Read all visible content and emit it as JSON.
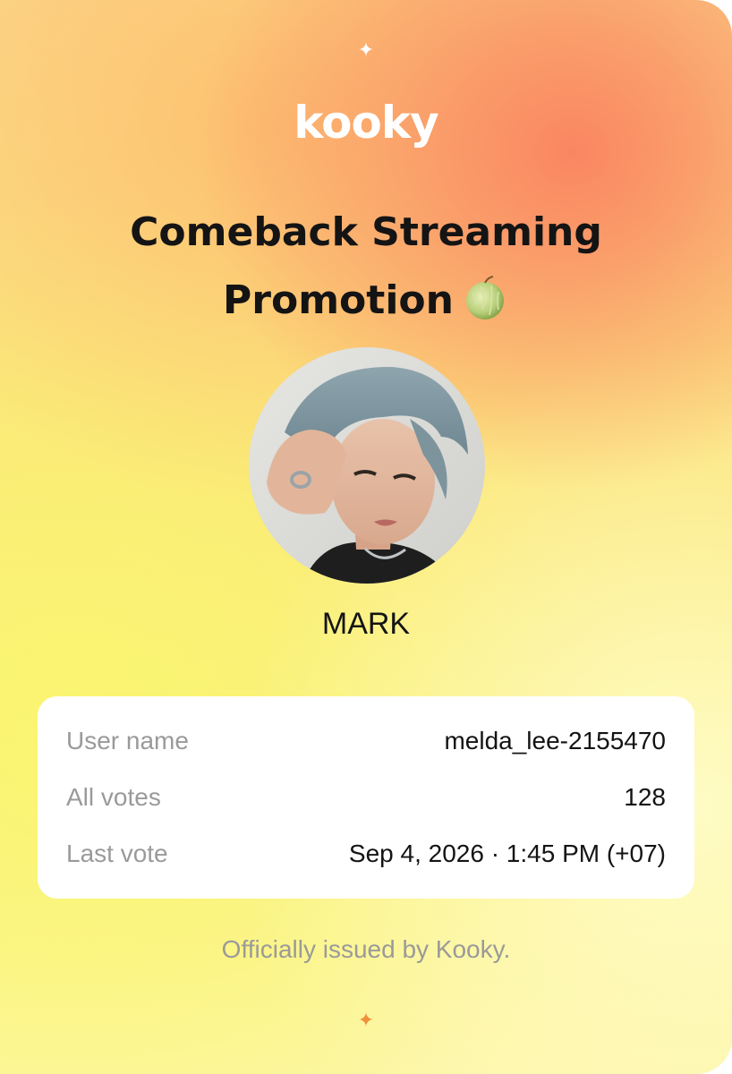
{
  "brand": {
    "name": "kooky"
  },
  "promotion": {
    "title_line1": "Comeback Streaming",
    "title_line2": "Promotion",
    "title_emoji_icon": "melon-icon"
  },
  "artist": {
    "name": "MARK"
  },
  "info": {
    "rows": [
      {
        "label": "User name",
        "value": "melda_lee-2155470"
      },
      {
        "label": "All votes",
        "value": "128"
      },
      {
        "label": "Last vote",
        "value": "Sep 4, 2026 · 1:45 PM (+07)"
      }
    ]
  },
  "footer": {
    "issued_text": "Officially issued by Kooky."
  },
  "icons": {
    "top": "sparkle-icon",
    "bottom": "sparkle-icon"
  },
  "colors": {
    "sparkle_top": "#ffffff",
    "sparkle_bottom": "#f0903a",
    "text_primary": "#141414",
    "text_muted": "#9a9a9a"
  }
}
